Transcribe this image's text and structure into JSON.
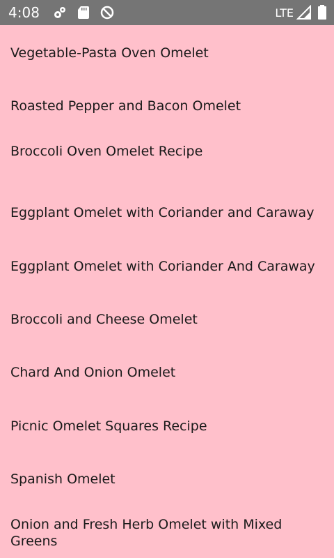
{
  "status_bar": {
    "time": "4:08",
    "network": "LTE",
    "icons": [
      "settings-gear-icon",
      "sd-card-icon",
      "data-saver-icon",
      "signal-icon",
      "battery-icon"
    ]
  },
  "recipes": [
    "Vegetable-Pasta Oven Omelet",
    "Roasted Pepper and Bacon Omelet",
    "Broccoli Oven Omelet Recipe",
    "Eggplant Omelet with Coriander and Caraway",
    "Eggplant Omelet with Coriander And Caraway",
    "Broccoli and Cheese Omelet",
    "Chard And Onion Omelet",
    "Picnic Omelet Squares Recipe",
    "Spanish Omelet",
    "Onion and Fresh Herb Omelet with Mixed Greens"
  ],
  "colors": {
    "background": "#ffc0cb",
    "status_bar": "#757575",
    "text": "#1a1a1a"
  }
}
